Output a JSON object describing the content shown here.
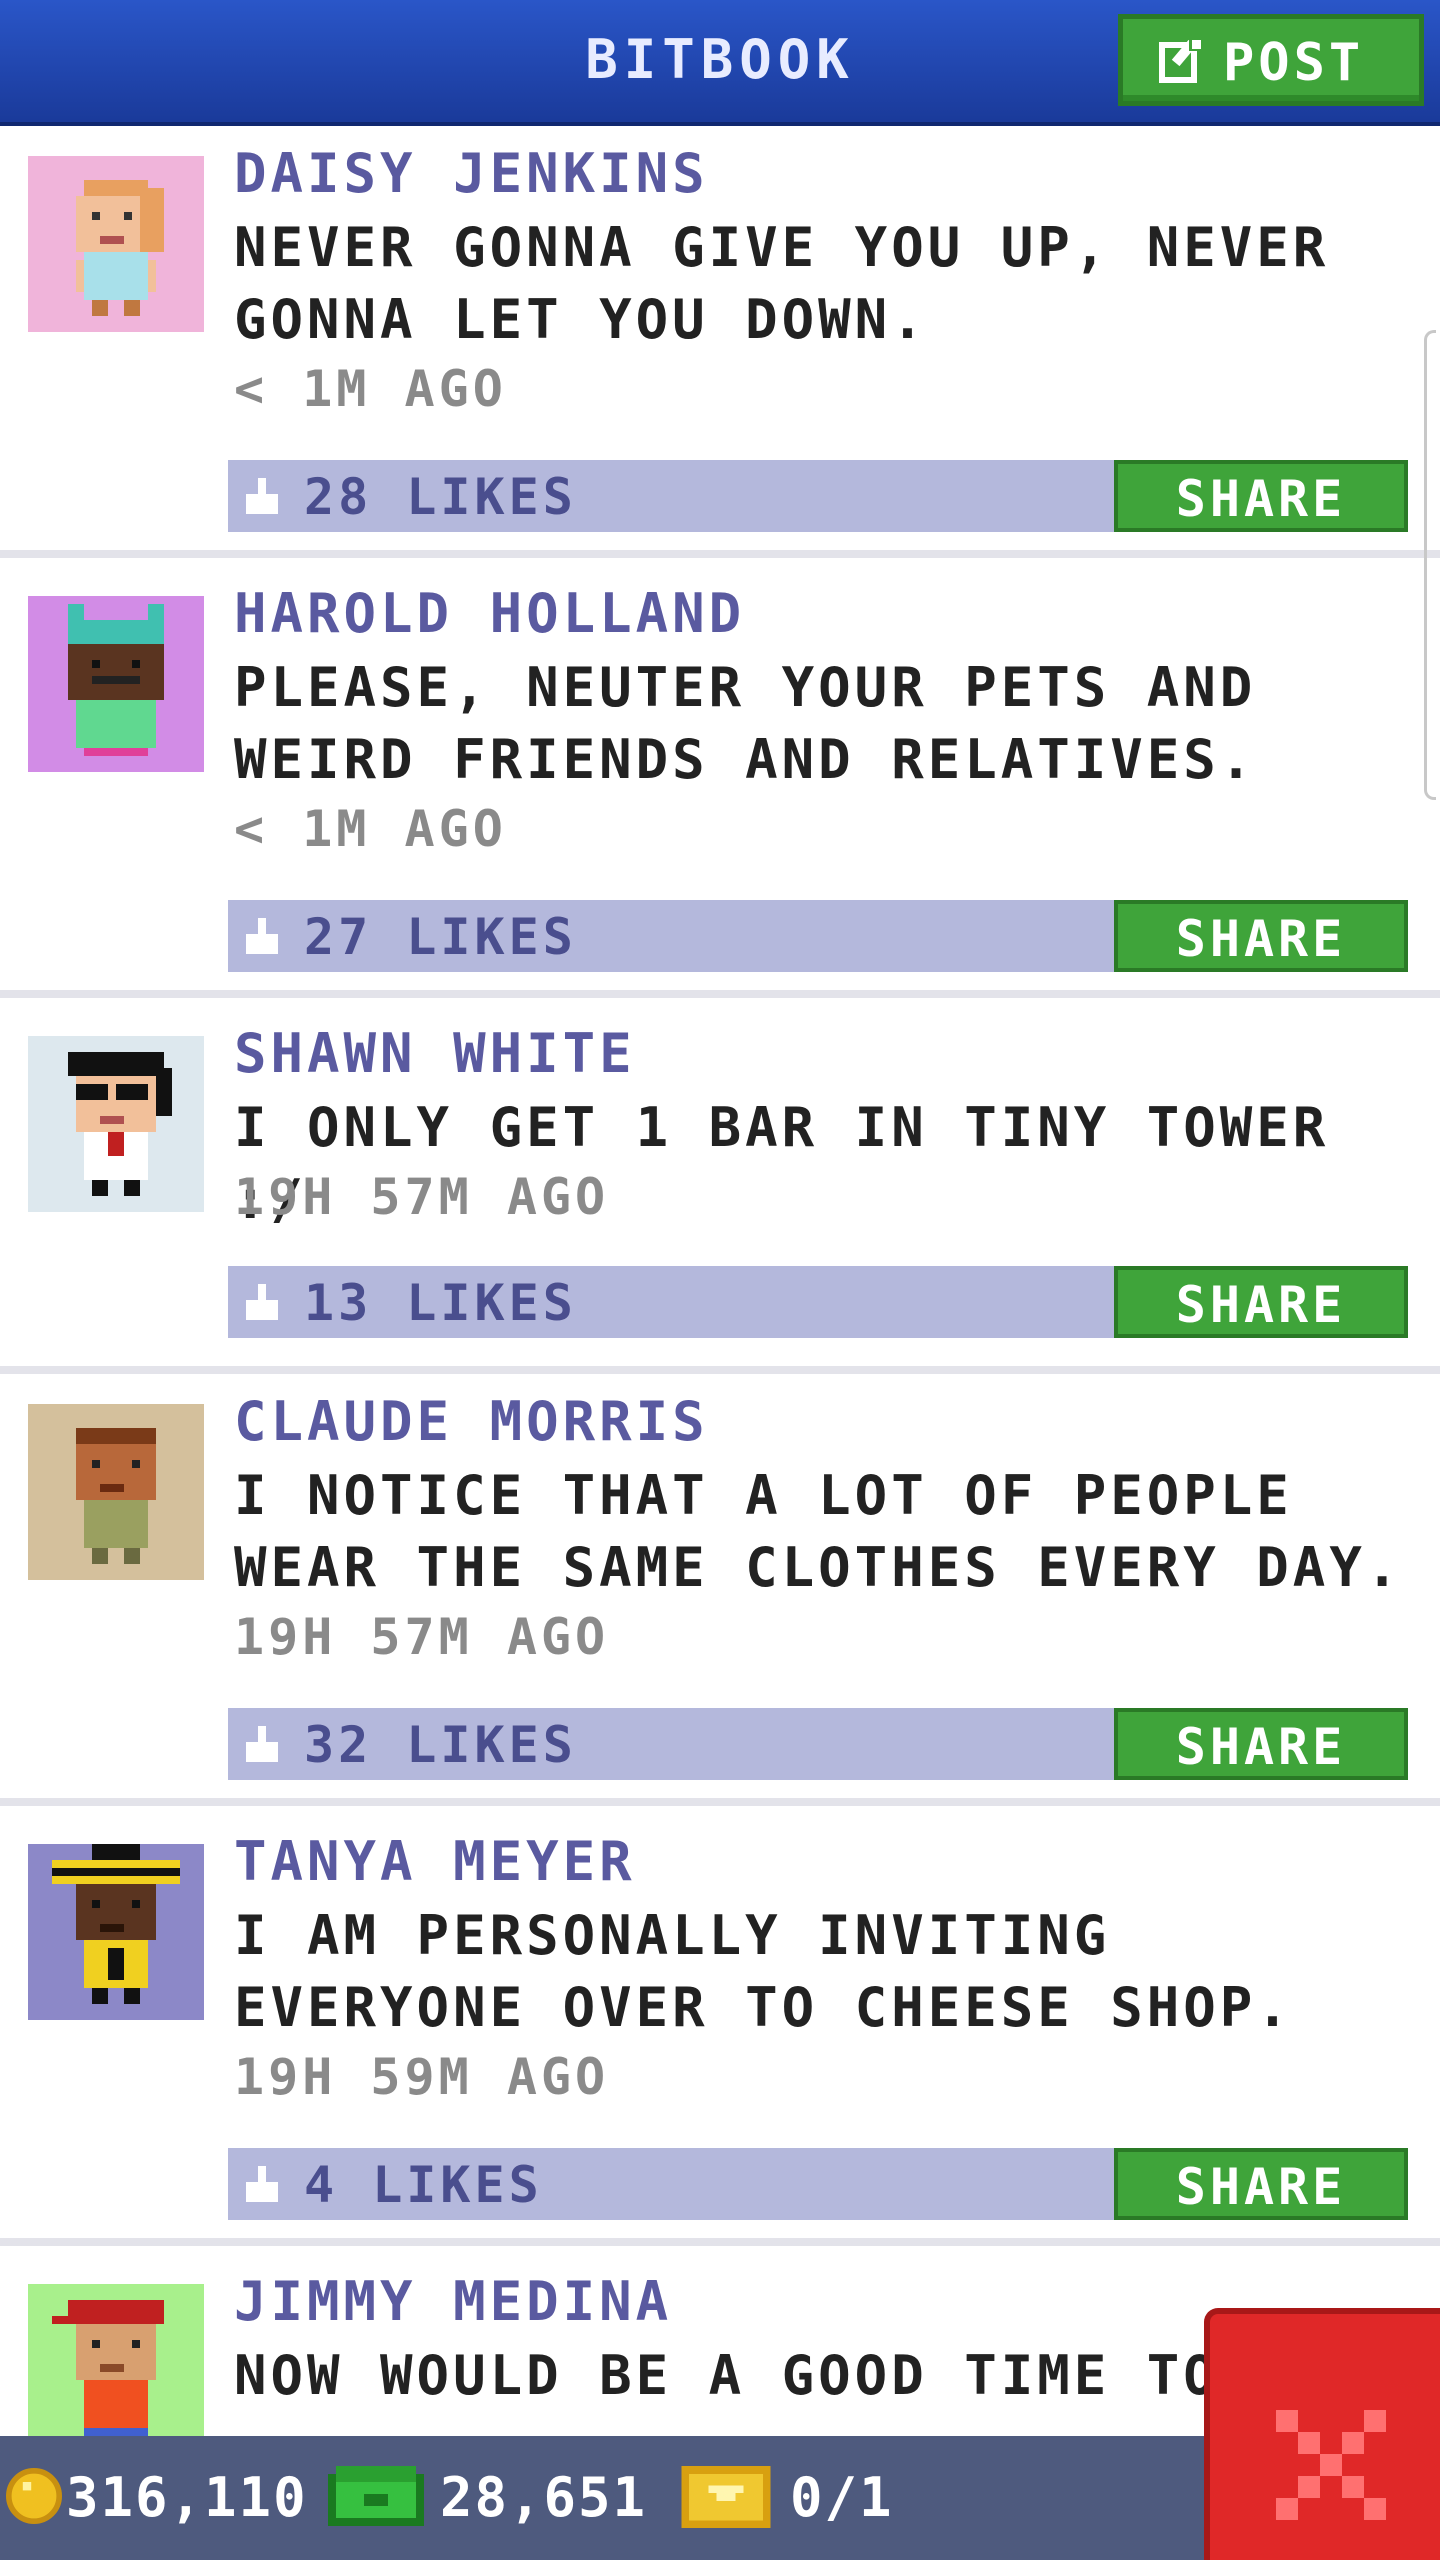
{
  "header": {
    "title": "BITBOOK",
    "post_label": "POST"
  },
  "colors": {
    "header_blue": "#2a56c8",
    "button_green": "#3fa43a",
    "likes_bar": "#b4b8dc",
    "author_purple": "#5a5aa0",
    "close_red": "#e02828",
    "status_bar": "#4e5a7e"
  },
  "posts": [
    {
      "author": "DAISY JENKINS",
      "message": "NEVER GONNA GIVE YOU UP, NEVER GONNA LET YOU DOWN.",
      "time": "< 1M AGO",
      "likes": "28 LIKES",
      "share_label": "SHARE",
      "avatar_bg": "#f0b4da"
    },
    {
      "author": "HAROLD HOLLAND",
      "message": "PLEASE, NEUTER YOUR PETS AND WEIRD FRIENDS AND RELATIVES.",
      "time": "< 1M AGO",
      "likes": "27 LIKES",
      "share_label": "SHARE",
      "avatar_bg": "#d28ce6"
    },
    {
      "author": "SHAWN WHITE",
      "message": "I ONLY GET 1 BAR IN TINY TOWER :/",
      "time": "19H 57M AGO",
      "likes": "13 LIKES",
      "share_label": "SHARE",
      "avatar_bg": "#dde8ee"
    },
    {
      "author": "CLAUDE MORRIS",
      "message": "I NOTICE THAT A LOT OF PEOPLE WEAR THE SAME CLOTHES EVERY DAY.",
      "time": "19H 57M AGO",
      "likes": "32 LIKES",
      "share_label": "SHARE",
      "avatar_bg": "#d4c09c"
    },
    {
      "author": "TANYA MEYER",
      "message": "I AM PERSONALLY INVITING EVERYONE OVER TO CHEESE SHOP.",
      "time": "19H 59M AGO",
      "likes": "4 LIKES",
      "share_label": "SHARE",
      "avatar_bg": "#8c88c8"
    },
    {
      "author": "JIMMY MEDINA",
      "message": "NOW WOULD BE A GOOD TIME TO",
      "avatar_bg": "#a8f08c"
    }
  ],
  "status": {
    "coins": "316,110",
    "bux": "28,651",
    "tickets": "0/1"
  },
  "icons": {
    "post": "edit-icon",
    "like": "thumbs-up-icon",
    "coin": "coin-icon",
    "bux": "bux-icon",
    "ticket": "ticket-icon",
    "close": "close-icon"
  }
}
